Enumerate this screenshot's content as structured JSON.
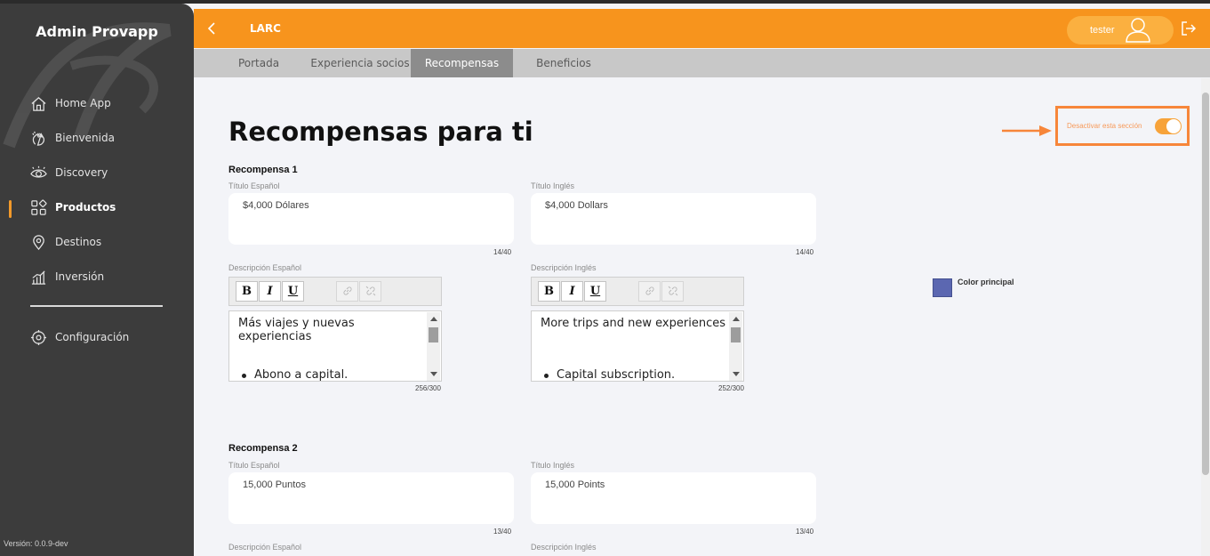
{
  "app": {
    "brand": "Admin Provapp",
    "version": "Versión: 0.0.9-dev"
  },
  "sidebar": {
    "items": [
      {
        "label": "Home App",
        "icon": "home-icon"
      },
      {
        "label": "Bienvenida",
        "icon": "wave-hand-icon"
      },
      {
        "label": "Discovery",
        "icon": "eye-icon"
      },
      {
        "label": "Productos",
        "icon": "grid-icon",
        "active": true
      },
      {
        "label": "Destinos",
        "icon": "location-pin-icon"
      },
      {
        "label": "Inversión",
        "icon": "bar-chart-icon"
      }
    ],
    "settings": {
      "label": "Configuración",
      "icon": "gear-icon"
    }
  },
  "header": {
    "title": "LARC",
    "user": "tester"
  },
  "tabs": [
    {
      "label": "Portada"
    },
    {
      "label": "Experiencia socios"
    },
    {
      "label": "Recompensas",
      "active": true
    },
    {
      "label": "Beneficios"
    }
  ],
  "main": {
    "title": "Recompensas para ti",
    "toggle": {
      "label": "Desactivar esta sección",
      "on": true
    },
    "color": {
      "label": "Color principal",
      "value": "#5b67b1"
    },
    "rewards": [
      {
        "heading": "Recompensa 1",
        "title_es_label": "Título Español",
        "title_es": "$4,000 Dólares",
        "title_es_count": "14/40",
        "title_en_label": "Título Inglés",
        "title_en": "$4,000 Dollars",
        "title_en_count": "14/40",
        "desc_es_label": "Descripción Español",
        "desc_es_text": "Más viajes y nuevas experiencias",
        "desc_es_bullet": "Abono a capital.",
        "desc_es_count": "256/300",
        "desc_en_label": "Descripción Inglés",
        "desc_en_text": "More trips and new experiences",
        "desc_en_bullet": "Capital subscription.",
        "desc_en_count": "252/300"
      },
      {
        "heading": "Recompensa 2",
        "title_es_label": "Título Español",
        "title_es": "15,000 Puntos",
        "title_es_count": "13/40",
        "title_en_label": "Título Inglés",
        "title_en": "15,000 Points",
        "title_en_count": "13/40",
        "desc_es_label": "Descripción Español",
        "desc_en_label": "Descripción Inglés"
      }
    ],
    "toolbar": {
      "bold": "B",
      "italic": "I",
      "underline": "U"
    }
  }
}
